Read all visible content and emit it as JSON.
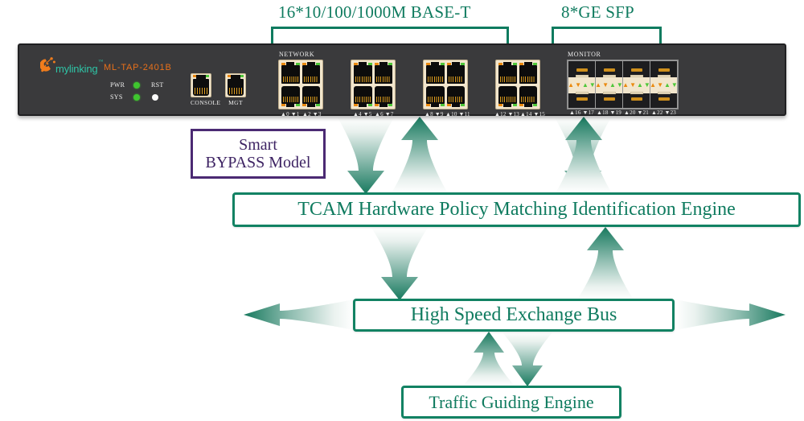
{
  "diagram": {
    "title": "Mylinking ML-TAP-2401B network TAP architecture",
    "accent_color": "#0f7b5f",
    "purple_color": "#3d2363",
    "device_body_color": "#3a3a3c"
  },
  "top_labels": {
    "network_ports": "16*10/100/1000M BASE-T",
    "sfp_ports": "8*GE SFP"
  },
  "device": {
    "brand": "mylinking",
    "trademark": "™",
    "model": "ML-TAP-2401B",
    "leds": [
      {
        "label": "PWR",
        "state_color": "#3fc62f"
      },
      {
        "label": "SYS",
        "state_color": "#3fc62f"
      }
    ],
    "reset": {
      "label": "RST",
      "state_color": "#fbfbfb"
    },
    "jacks": [
      {
        "caption": "CONSOLE"
      },
      {
        "caption": "MGT"
      }
    ],
    "network_section": {
      "title": "NETWORK",
      "blocks": [
        {
          "labels": [
            "▲0 ▼1",
            "▲2 ▼3"
          ]
        },
        {
          "labels": [
            "▲4 ▼5",
            "▲6 ▼7"
          ]
        },
        {
          "labels": [
            "▲8 ▼9",
            "▲10 ▼11"
          ]
        },
        {
          "labels": [
            "▲12 ▼13",
            "▲14 ▼15"
          ]
        }
      ]
    },
    "monitor_section": {
      "title": "MONITOR",
      "blocks": [
        {
          "label": "▲16 ▼17"
        },
        {
          "label": "▲18 ▼19"
        },
        {
          "label": "▲20 ▼21"
        },
        {
          "label": "▲22 ▼23"
        }
      ]
    }
  },
  "callout": {
    "line1": "Smart",
    "line2": "BYPASS Model"
  },
  "flow_boxes": {
    "tcam": "TCAM Hardware Policy Matching Identification Engine",
    "bus": "High Speed Exchange Bus",
    "traffic": "Traffic Guiding Engine"
  }
}
